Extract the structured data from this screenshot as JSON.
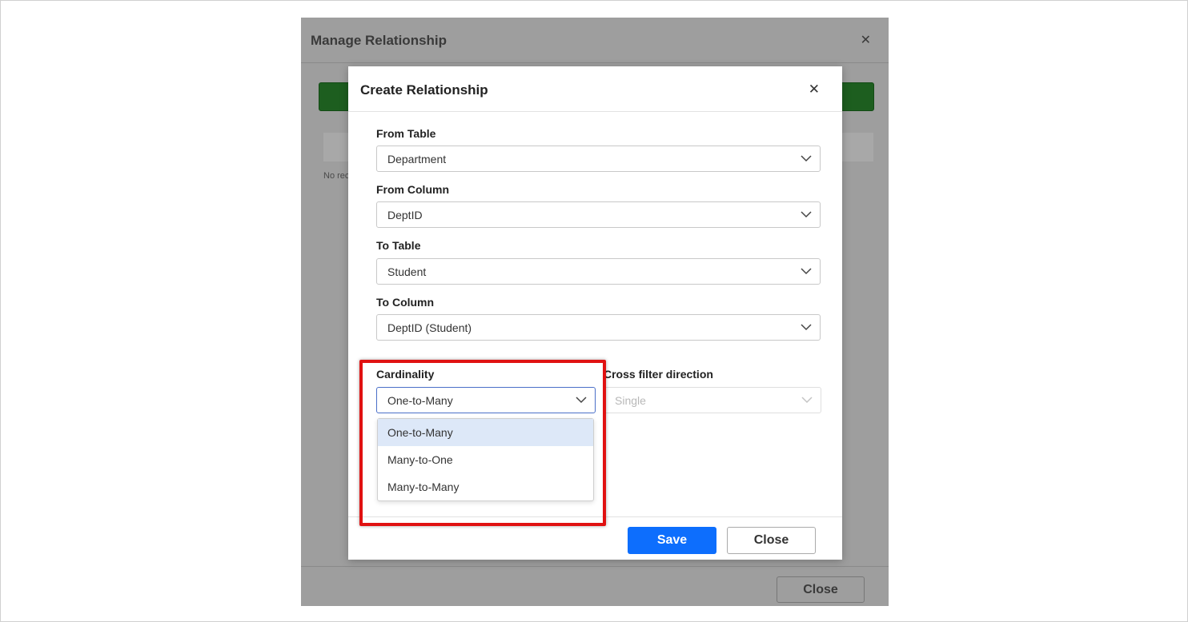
{
  "background_dialog": {
    "title": "Manage Relationship",
    "close_glyph": "✕",
    "no_records_text": "No records to display",
    "close_button_label": "Close"
  },
  "dialog": {
    "title": "Create Relationship",
    "close_glyph": "✕",
    "from_table": {
      "label": "From Table",
      "value": "Department"
    },
    "from_column": {
      "label": "From Column",
      "value": "DeptID"
    },
    "to_table": {
      "label": "To Table",
      "value": "Student"
    },
    "to_column": {
      "label": "To Column",
      "value": "DeptID (Student)"
    },
    "cardinality": {
      "label": "Cardinality",
      "value": "One-to-Many",
      "options": [
        "One-to-Many",
        "Many-to-One",
        "Many-to-Many"
      ],
      "expanded": true
    },
    "cross_filter": {
      "label": "Cross filter direction",
      "value": "Single",
      "disabled": true
    },
    "save_label": "Save",
    "close_label": "Close"
  },
  "colors": {
    "primary": "#0d6efd",
    "highlight": "#e01111",
    "selected_option": "#dde8f8",
    "green_button": "#1d5e1f"
  },
  "icons": {
    "close": "close-icon",
    "dropdown": "chevron-down-icon"
  }
}
